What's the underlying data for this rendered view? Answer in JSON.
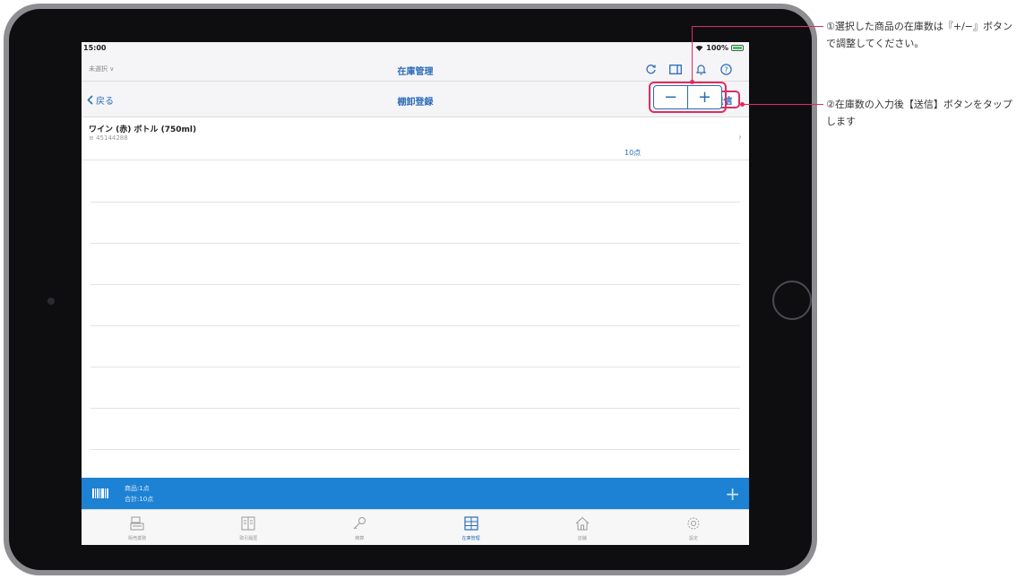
{
  "status_bar": {
    "time": "15:00",
    "battery": "100%"
  },
  "app_bar": {
    "store_selector": "未選択 ∨",
    "title": "在庫管理"
  },
  "nav_bar": {
    "back_label": "戻る",
    "title": "棚卸登録",
    "send_label": "送信"
  },
  "item": {
    "name": "ワイン (赤) ボトル (750ml)",
    "code": "≡ 45144288",
    "quantity": "10点",
    "minus": "−",
    "plus": "+"
  },
  "summary": {
    "products": "商品:1点",
    "total": "合計:10点",
    "add": "+"
  },
  "tabs": [
    {
      "label": "販売業務",
      "icon": "register-icon"
    },
    {
      "label": "取引履歴",
      "icon": "ledger-icon"
    },
    {
      "label": "精算",
      "icon": "key-icon"
    },
    {
      "label": "在庫管理",
      "icon": "inventory-icon"
    },
    {
      "label": "店舗",
      "icon": "home-icon"
    },
    {
      "label": "設定",
      "icon": "gear-icon"
    }
  ],
  "callouts": {
    "one": "①選択した商品の在庫数は『+/−』ボタンで調整してください。",
    "two": "②在庫数の入力後【送信】ボタンをタップします"
  },
  "colors": {
    "accent": "#2b6cb8",
    "highlight": "#e02d5f",
    "summary_bar": "#1d82d4"
  }
}
